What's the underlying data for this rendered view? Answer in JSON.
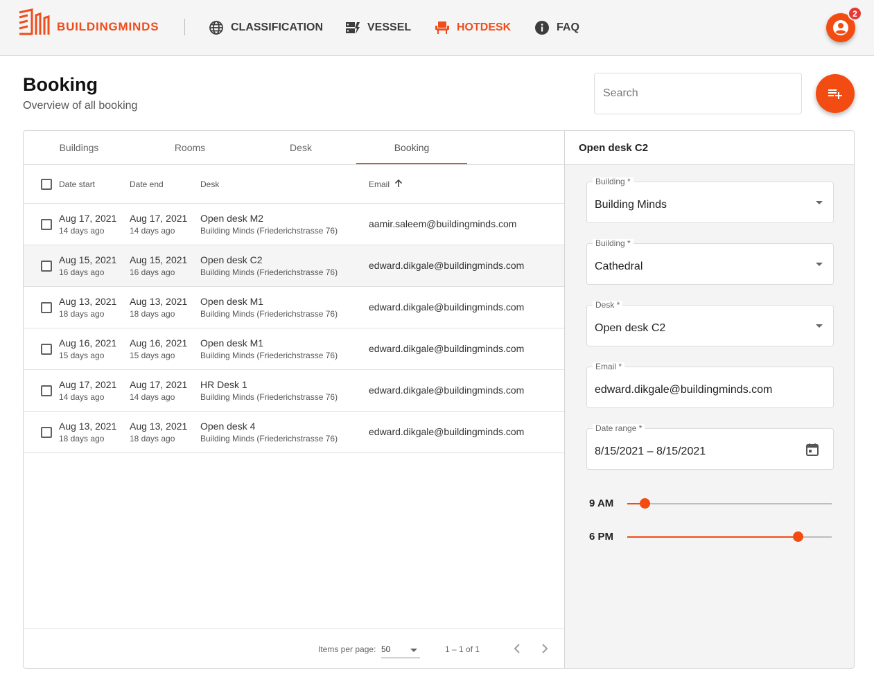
{
  "brand": {
    "name": "BUILDINGMINDS"
  },
  "nav": [
    {
      "label": "CLASSIFICATION",
      "icon": "globe-icon"
    },
    {
      "label": "VESSEL",
      "icon": "vessel-icon"
    },
    {
      "label": "HOTDESK",
      "icon": "chair-icon",
      "active": true
    },
    {
      "label": "FAQ",
      "icon": "info-icon"
    }
  ],
  "account": {
    "badge_count": "2"
  },
  "colors": {
    "accent": "#ee4d1c",
    "fab": "#f24c12"
  },
  "header": {
    "title": "Booking",
    "subtitle": "Overview of all booking"
  },
  "search": {
    "placeholder": "Search",
    "value": ""
  },
  "tabs": [
    "Buildings",
    "Rooms",
    "Desk",
    "Booking"
  ],
  "active_tab": "Booking",
  "table": {
    "columns": [
      "Date start",
      "Date end",
      "Desk",
      "Email"
    ],
    "sort": {
      "column": "Email",
      "direction": "ascending"
    },
    "rows": [
      {
        "start": "Aug 17, 2021",
        "start_ago": "14 days ago",
        "end": "Aug 17, 2021",
        "end_ago": "14 days ago",
        "desk": "Open desk M2",
        "location": "Building Minds (Friederichstrasse 76)",
        "email": "aamir.saleem@buildingminds.com"
      },
      {
        "start": "Aug 15, 2021",
        "start_ago": "16 days ago",
        "end": "Aug 15, 2021",
        "end_ago": "16 days ago",
        "desk": "Open desk C2",
        "location": "Building Minds (Friederichstrasse 76)",
        "email": "edward.dikgale@buildingminds.com",
        "selected": true
      },
      {
        "start": "Aug 13, 2021",
        "start_ago": "18 days ago",
        "end": "Aug 13, 2021",
        "end_ago": "18 days ago",
        "desk": "Open desk M1",
        "location": "Building Minds (Friederichstrasse 76)",
        "email": "edward.dikgale@buildingminds.com"
      },
      {
        "start": "Aug 16, 2021",
        "start_ago": "15 days ago",
        "end": "Aug 16, 2021",
        "end_ago": "15 days ago",
        "desk": "Open desk M1",
        "location": "Building Minds (Friederichstrasse 76)",
        "email": "edward.dikgale@buildingminds.com"
      },
      {
        "start": "Aug 17, 2021",
        "start_ago": "14 days ago",
        "end": "Aug 17, 2021",
        "end_ago": "14 days ago",
        "desk": "HR Desk 1",
        "location": "Building Minds (Friederichstrasse 76)",
        "email": "edward.dikgale@buildingminds.com"
      },
      {
        "start": "Aug 13, 2021",
        "start_ago": "18 days ago",
        "end": "Aug 13, 2021",
        "end_ago": "18 days ago",
        "desk": "Open desk 4",
        "location": "Building Minds (Friederichstrasse 76)",
        "email": "edward.dikgale@buildingminds.com"
      }
    ]
  },
  "paginator": {
    "items_per_page_label": "Items per page:",
    "items_per_page": "50",
    "range": "1 – 1 of 1"
  },
  "detail": {
    "title": "Open desk C2",
    "fields": [
      {
        "label": "Building *",
        "value": "Building Minds",
        "type": "select"
      },
      {
        "label": "Building *",
        "value": "Cathedral",
        "type": "select"
      },
      {
        "label": "Desk *",
        "value": "Open desk C2",
        "type": "select"
      },
      {
        "label": "Email *",
        "value": "edward.dikgale@buildingminds.com",
        "type": "text"
      },
      {
        "label": "Date range *",
        "value": "8/15/2021 – 8/15/2021",
        "type": "date"
      }
    ],
    "time_start": {
      "label": "9 AM",
      "level": 0.085
    },
    "time_end": {
      "label": "6 PM",
      "level": 0.835
    }
  }
}
